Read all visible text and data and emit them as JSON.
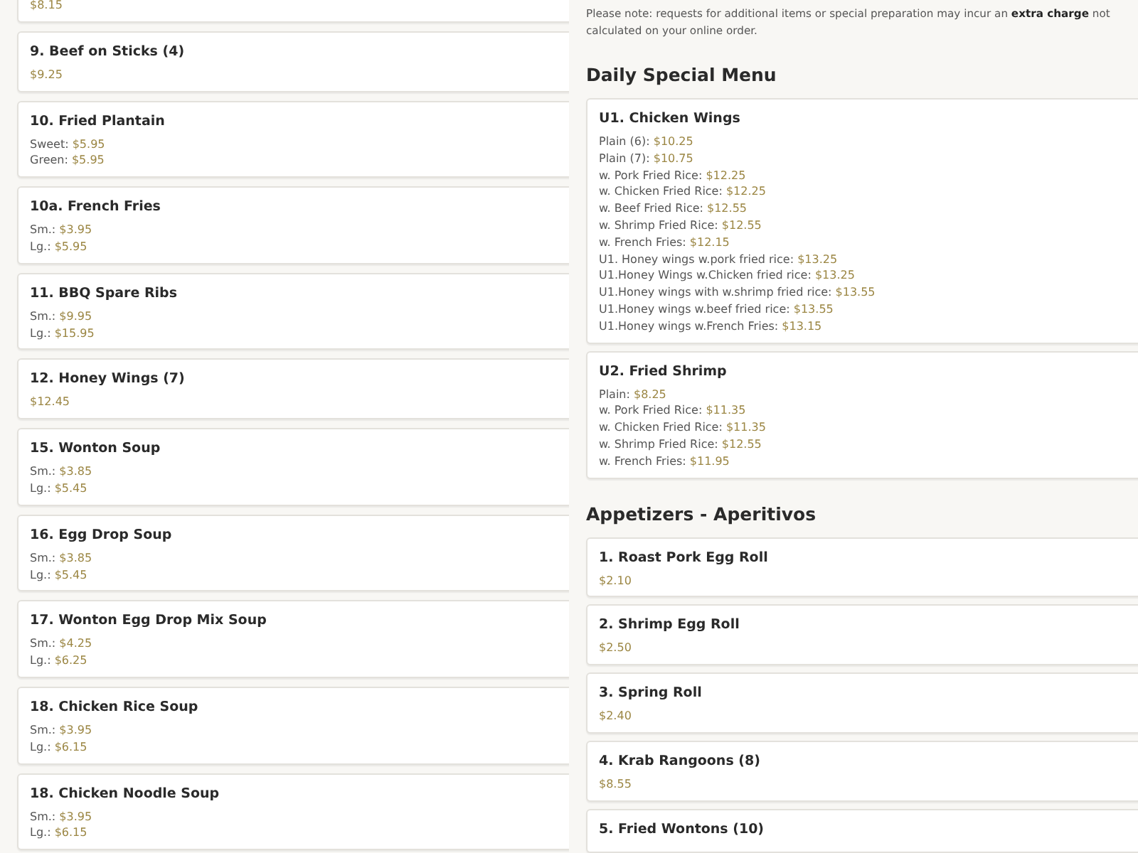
{
  "left_column": {
    "items": [
      {
        "prices": [
          {
            "price": "$8.15"
          }
        ]
      },
      {
        "name": "9. Beef on Sticks (4)",
        "prices": [
          {
            "price": "$9.25"
          }
        ]
      },
      {
        "name": "10. Fried Plantain",
        "prices": [
          {
            "label": "Sweet:",
            "price": "$5.95"
          },
          {
            "label": "Green:",
            "price": "$5.95"
          }
        ]
      },
      {
        "name": "10a. French Fries",
        "prices": [
          {
            "label": "Sm.:",
            "price": "$3.95"
          },
          {
            "label": "Lg.:",
            "price": "$5.95"
          }
        ]
      },
      {
        "name": "11. BBQ Spare Ribs",
        "prices": [
          {
            "label": "Sm.:",
            "price": "$9.95"
          },
          {
            "label": "Lg.:",
            "price": "$15.95"
          }
        ]
      },
      {
        "name": "12. Honey Wings (7)",
        "prices": [
          {
            "price": "$12.45"
          }
        ]
      },
      {
        "name": "15. Wonton Soup",
        "prices": [
          {
            "label": "Sm.:",
            "price": "$3.85"
          },
          {
            "label": "Lg.:",
            "price": "$5.45"
          }
        ]
      },
      {
        "name": "16. Egg Drop Soup",
        "prices": [
          {
            "label": "Sm.:",
            "price": "$3.85"
          },
          {
            "label": "Lg.:",
            "price": "$5.45"
          }
        ]
      },
      {
        "name": "17. Wonton Egg Drop Mix Soup",
        "prices": [
          {
            "label": "Sm.:",
            "price": "$4.25"
          },
          {
            "label": "Lg.:",
            "price": "$6.25"
          }
        ]
      },
      {
        "name": "18. Chicken Rice Soup",
        "prices": [
          {
            "label": "Sm.:",
            "price": "$3.95"
          },
          {
            "label": "Lg.:",
            "price": "$6.15"
          }
        ]
      },
      {
        "name": "18. Chicken Noodle Soup",
        "prices": [
          {
            "label": "Sm.:",
            "price": "$3.95"
          },
          {
            "label": "Lg.:",
            "price": "$6.15"
          }
        ]
      }
    ]
  },
  "right_column": {
    "note": "Please note: requests for additional items or special preparation may incur an **extra charge** not calculated on your online order.",
    "sections": [
      {
        "heading": "Daily Special Menu",
        "items": [
          {
            "name": "U1. Chicken Wings",
            "prices": [
              {
                "label": "Plain (6):",
                "price": "$10.25"
              },
              {
                "label": "Plain (7):",
                "price": "$10.75"
              },
              {
                "label": "w. Pork Fried Rice:",
                "price": "$12.25"
              },
              {
                "label": "w. Chicken Fried Rice:",
                "price": "$12.25"
              },
              {
                "label": "w. Beef Fried Rice:",
                "price": "$12.55"
              },
              {
                "label": "w. Shrimp Fried Rice:",
                "price": "$12.55"
              },
              {
                "label": "w. French Fries:",
                "price": "$12.15"
              },
              {
                "label": "U1. Honey wings w.pork fried rice:",
                "price": "$13.25"
              },
              {
                "label": "U1.Honey Wings w.Chicken fried rice:",
                "price": "$13.25"
              },
              {
                "label": "U1.Honey wings with w.shrimp fried rice:",
                "price": "$13.55"
              },
              {
                "label": "U1.Honey wings w.beef fried rice:",
                "price": "$13.55"
              },
              {
                "label": "U1.Honey wings w.French Fries:",
                "price": "$13.15"
              }
            ]
          },
          {
            "name": "U2. Fried Shrimp",
            "prices": [
              {
                "label": "Plain:",
                "price": "$8.25"
              },
              {
                "label": "w. Pork Fried Rice:",
                "price": "$11.35"
              },
              {
                "label": "w. Chicken Fried Rice:",
                "price": "$11.35"
              },
              {
                "label": "w. Shrimp Fried Rice:",
                "price": "$12.55"
              },
              {
                "label": "w. French Fries:",
                "price": "$11.95"
              }
            ]
          }
        ]
      },
      {
        "heading": "Appetizers - Aperitivos",
        "items": [
          {
            "name": "1. Roast Pork Egg Roll",
            "prices": [
              {
                "price": "$2.10"
              }
            ]
          },
          {
            "name": "2. Shrimp Egg Roll",
            "prices": [
              {
                "price": "$2.50"
              }
            ]
          },
          {
            "name": "3. Spring Roll",
            "prices": [
              {
                "price": "$2.40"
              }
            ]
          },
          {
            "name": "4. Krab Rangoons (8)",
            "prices": [
              {
                "price": "$8.55"
              }
            ]
          },
          {
            "name": "5. Fried Wontons (10)"
          }
        ]
      }
    ]
  }
}
